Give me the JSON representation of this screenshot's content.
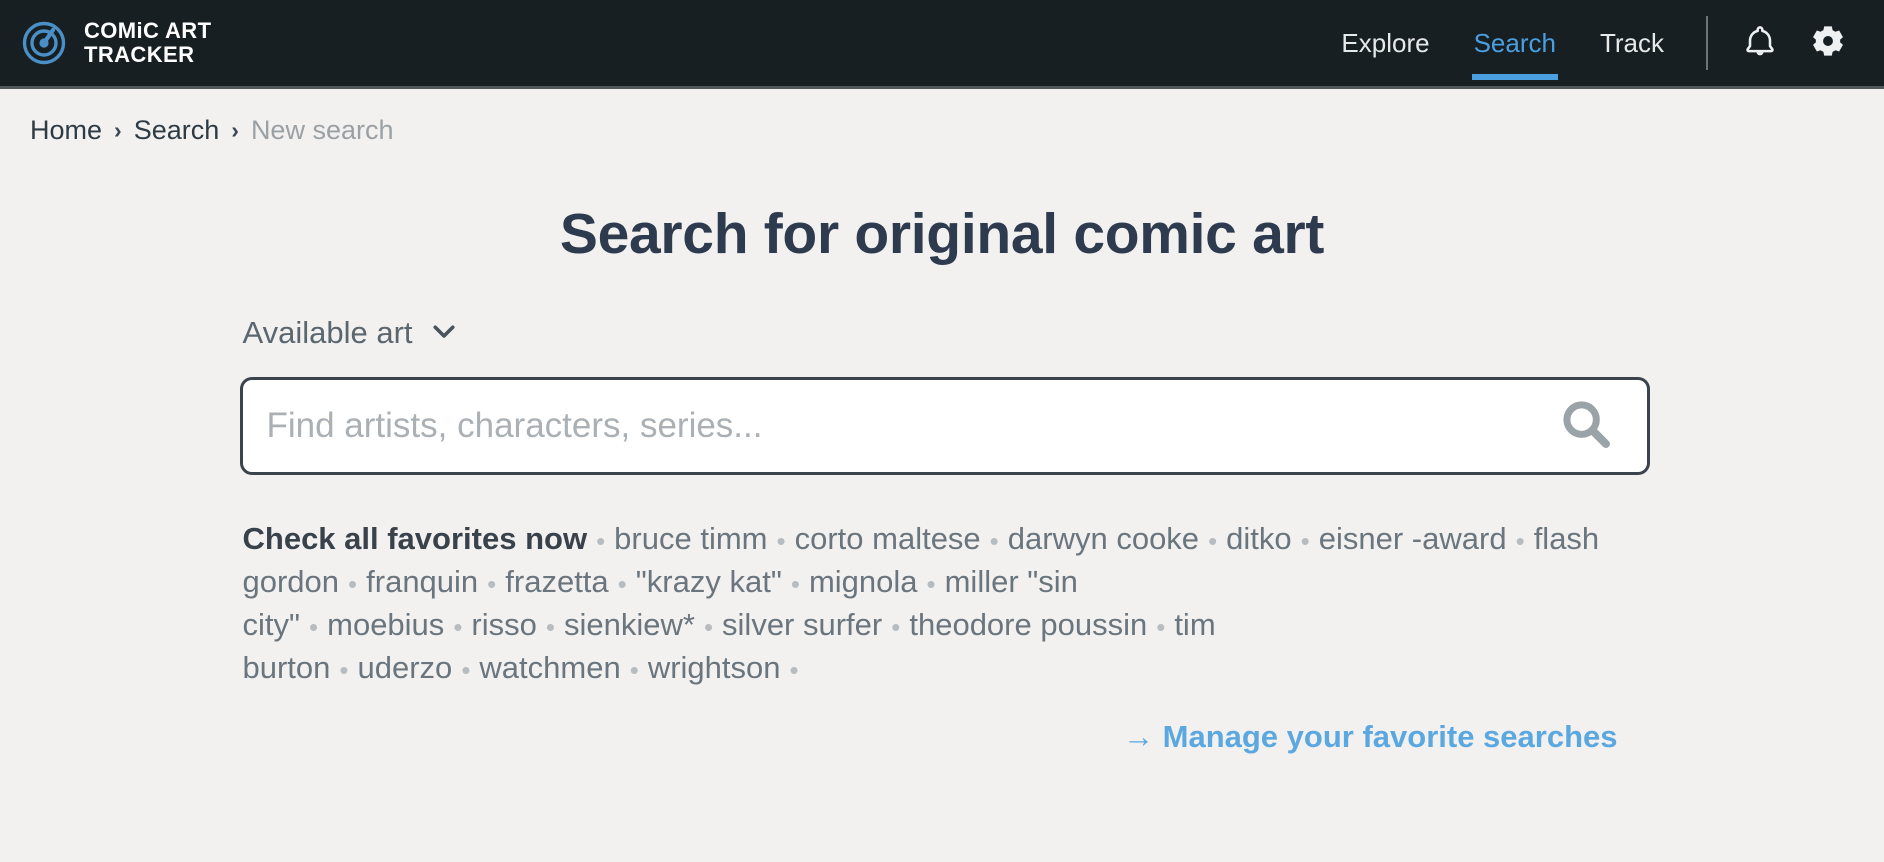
{
  "header": {
    "brand": {
      "line1": "COMiC ART",
      "line2": "TRACKER",
      "logo_color": "#4a8fc7"
    },
    "nav": [
      {
        "label": "Explore",
        "active": false
      },
      {
        "label": "Search",
        "active": true
      },
      {
        "label": "Track",
        "active": false
      }
    ],
    "icons": [
      {
        "name": "bell-icon",
        "label": "Notifications"
      },
      {
        "name": "gear-icon",
        "label": "Settings"
      }
    ],
    "accent_color": "#4a9fe0",
    "background_color": "#171f22"
  },
  "breadcrumb": {
    "items": [
      {
        "label": "Home",
        "muted": false
      },
      {
        "label": "Search",
        "muted": false
      },
      {
        "label": "New search",
        "muted": true
      }
    ],
    "separator": "›"
  },
  "main": {
    "title": "Search for original comic art",
    "filter": {
      "label": "Available art",
      "icon": "chevron-down-icon"
    },
    "search": {
      "value": "",
      "placeholder": "Find artists, characters, series...",
      "icon": "search-icon"
    },
    "favorites": {
      "heading": "Check all favorites now",
      "separator": "•",
      "tags": [
        "bruce timm",
        "corto maltese",
        "darwyn cooke",
        "ditko",
        "eisner -award",
        "flash gordon",
        "franquin",
        "frazetta",
        "\"krazy kat\"",
        "mignola",
        "miller \"sin city\"",
        "moebius",
        "risso",
        "sienkiew*",
        "silver surfer",
        "theodore poussin",
        "tim burton",
        "uderzo",
        "watchmen",
        "wrightson"
      ]
    },
    "manage_link": "→ Manage your favorite searches"
  }
}
